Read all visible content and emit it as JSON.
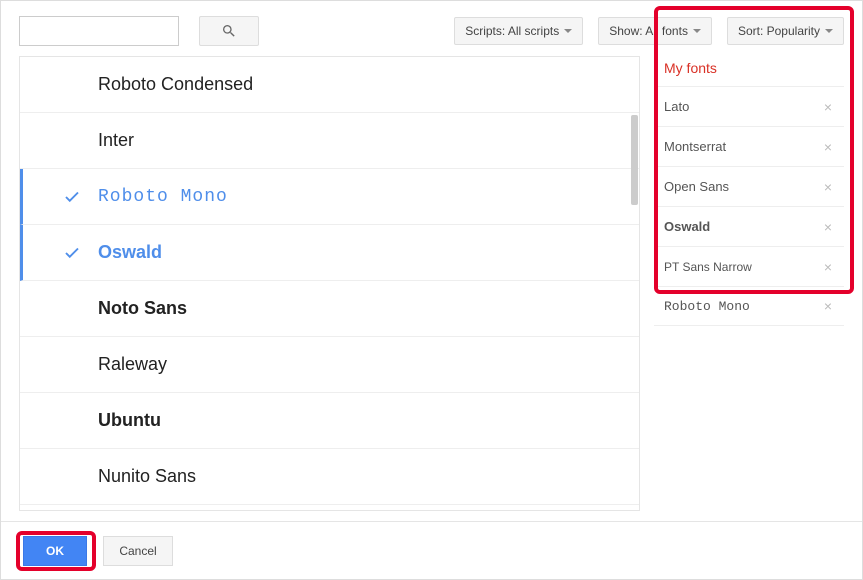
{
  "filters": {
    "scripts": "Scripts: All scripts",
    "show": "Show: All fonts",
    "sort": "Sort: Popularity"
  },
  "font_list": [
    {
      "name": "Roboto Condensed",
      "selected": false,
      "cls": "ff-condensed"
    },
    {
      "name": "Inter",
      "selected": false,
      "cls": "ff-sans"
    },
    {
      "name": "Roboto Mono",
      "selected": true,
      "cls": "ff-mono"
    },
    {
      "name": "Oswald",
      "selected": true,
      "cls": "ff-condensed ff-bold"
    },
    {
      "name": "Noto Sans",
      "selected": false,
      "cls": "ff-sans ff-bold"
    },
    {
      "name": "Raleway",
      "selected": false,
      "cls": "ff-sans"
    },
    {
      "name": "Ubuntu",
      "selected": false,
      "cls": "ff-sans ff-bold"
    },
    {
      "name": "Nunito Sans",
      "selected": false,
      "cls": "ff-sans"
    }
  ],
  "sidebar": {
    "title": "My fonts",
    "items": [
      {
        "name": "Lato",
        "cls": ""
      },
      {
        "name": "Montserrat",
        "cls": ""
      },
      {
        "name": "Open Sans",
        "cls": ""
      },
      {
        "name": "Oswald",
        "cls": "mf-bold"
      },
      {
        "name": "PT Sans Narrow",
        "cls": "mf-narrow"
      },
      {
        "name": "Roboto Mono",
        "cls": "mf-mono"
      }
    ]
  },
  "buttons": {
    "ok": "OK",
    "cancel": "Cancel"
  }
}
